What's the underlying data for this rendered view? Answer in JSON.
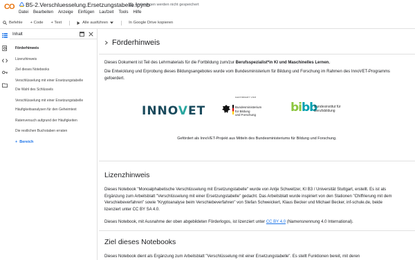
{
  "header": {
    "logo": "CO",
    "title": "B5-2.Verschluesselung.Ersetzungstabelle.ipynb",
    "saved_status": "Änderungen werden nicht gespeichert",
    "menu": [
      "Datei",
      "Bearbeiten",
      "Anzeige",
      "Einfügen",
      "Laufzeit",
      "Tools",
      "Hilfe"
    ]
  },
  "toolbar": {
    "commands": "Befehle",
    "code": "+ Code",
    "text": "+ Text",
    "run_all": "Alle ausführen",
    "copy_drive": "In Google Drive kopieren"
  },
  "sidebar": {
    "title": "Inhalt",
    "items": [
      {
        "label": "Förderhinweis"
      },
      {
        "label": "Lizenzhinweis"
      },
      {
        "label": "Ziel dieses Notebooks"
      },
      {
        "label": "Verschlüsselung mit einer Ersetzungstabelle"
      },
      {
        "label": "Die Wahl des Schlüssels"
      },
      {
        "label": "Verschlüsselung mit einer Ersetzungstabelle"
      },
      {
        "label": "Häufigkeitsanalysen für den Geheimtext"
      },
      {
        "label": "Ratenversuch aufgrund der Häufigkeiten"
      },
      {
        "label": "Die restlichen Buchstaben erraten"
      }
    ],
    "add_section": "Bereich"
  },
  "main": {
    "funding_heading": "Förderhinweis",
    "funding_p1_pre": "Dieses Dokument ist Teil des Lehrmaterials für die Fortbildung zum/zur ",
    "funding_p1_bold": "Berufsspezialist*in KI und Maschinelles Lernen.",
    "funding_p2": "Die Entwicklung und Erprobung dieses Bildungsangebotes wurde vom Bundesministerium für Bildung und Forschung im Rahmen des InnoVET-Programms gefoerdert.",
    "logos": {
      "innovet_a": "INNO",
      "innovet_v": "V",
      "innovet_b": "ET",
      "bmbf_caption": "GEFÖRDERT VOM",
      "bmbf_line1": "Bundesministerium",
      "bmbf_line2": "für Bildung",
      "bmbf_line3": "und Forschung",
      "bibb_mark_a": "bi",
      "bibb_mark_b": "bb",
      "bibb_line1": "Bundesinstitut für",
      "bibb_line2": "Berufsbildung"
    },
    "logos_caption": "Gefördert als InnoVET-Projekt aus Mitteln des Bundesministeriums für Bildung und Forschung.",
    "license_heading": "Lizenzhinweis",
    "license_p1": "Dieses Notebook \"Monoalphabetische Verschlüsselung mit Ersetzungstabelle\" wurde von Antje Schweitzer, KI B3 / Universität Stuttgart, erstellt. Es ist als Ergänzung zum Arbeitsblatt \"Verschlüsselung mit einer Ersetzungstabelle\" gedacht. Das Arbeitsblatt wurde inspiriert von den Stationen \"Chiffrierung mit dem Verschiebeverfahren\" sowie \"Kryptoanalyse beim Verschiebeverfahren\" von Stefan Schweickert, Klaus Becker und Michael Becker, inf-schule.de, beide lizenziert unter CC BY SA 4.0.",
    "license_p2_pre": "Dieses Notebook, mit Ausnahme der oben abgebildeten Förderlogos, ist lizenziert unter ",
    "license_p2_link": "CC BY 4.0",
    "license_p2_post": " (Namensnennung 4.0 International).",
    "goal_heading": "Ziel dieses Notebooks",
    "goal_p1": "Dieses Notebook dient als Ergänzung zum Arbeitsblatt \"Verschlüsselung mit einer Ersetzungstabelle\". Es stellt Funktionen bereit, mit deren"
  }
}
